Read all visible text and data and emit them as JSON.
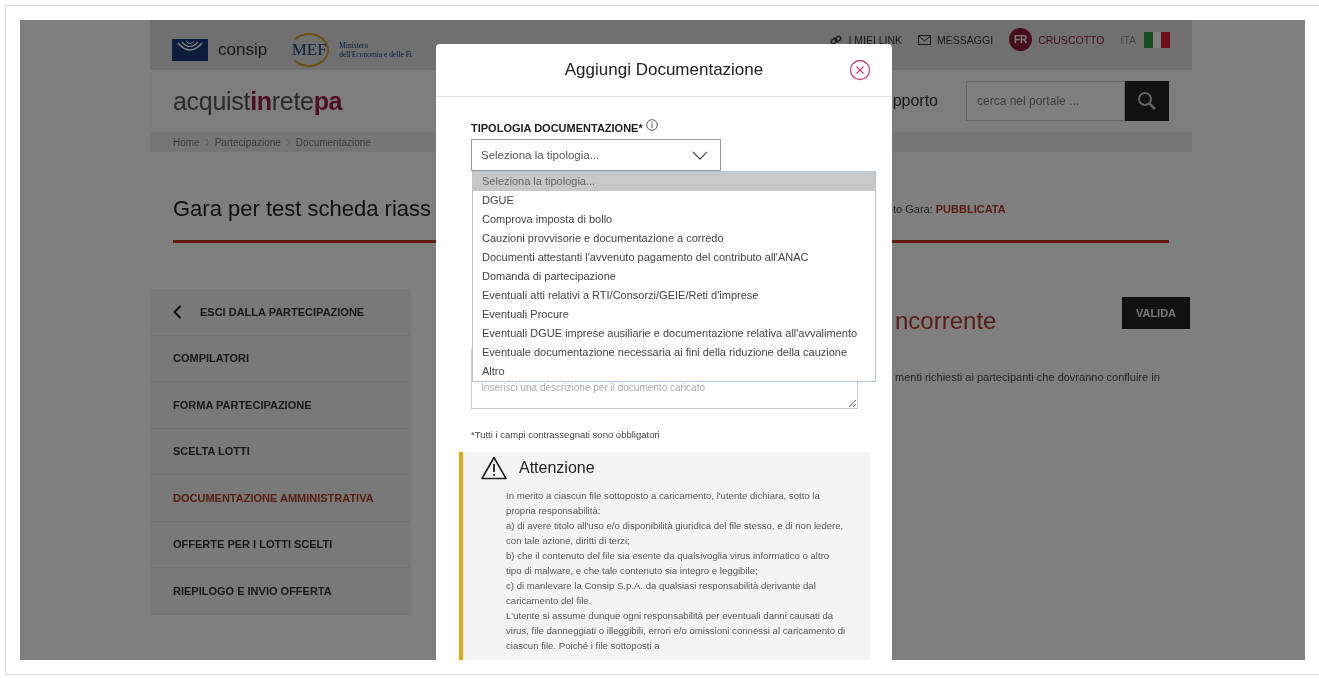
{
  "top_bar": {
    "logo_text": "consip",
    "ministry_logo_text": "MEF",
    "ministry_lines": [
      "Ministero",
      "dell'Economia e delle Fi"
    ],
    "links": [
      {
        "kind": "link",
        "label": "I MIEI LINK"
      },
      {
        "kind": "messages",
        "label": "MESSAGGI"
      },
      {
        "kind": "user",
        "initials": "FR",
        "label": "CRUSCOTTO"
      },
      {
        "kind": "language",
        "label": "ITA"
      }
    ]
  },
  "header": {
    "brand": [
      {
        "text": "acquist",
        "accent": false
      },
      {
        "text": "in",
        "accent": true
      },
      {
        "text": "rete",
        "accent": false
      },
      {
        "text": "pa",
        "accent": true
      }
    ],
    "nav_fragment": "pporto",
    "search": {
      "placeholder": "cerca nel portale ..."
    }
  },
  "breadcrumb": [
    "Home",
    "Partecipazione",
    "Documentazione"
  ],
  "page_title": "Gara per test scheda riass",
  "status_label": "to Gara:",
  "status_value": "PUBBLICATA",
  "sidebar": {
    "back_label": "ESCI DALLA PARTECIPAZIONE",
    "items": [
      {
        "label": "COMPILATORI",
        "selected": false
      },
      {
        "label": "FORMA PARTECIPAZIONE",
        "selected": false
      },
      {
        "label": "SCELTA LOTTI",
        "selected": false
      },
      {
        "label": "DOCUMENTAZIONE AMMINISTRATIVA",
        "selected": true
      },
      {
        "label": "OFFERTE PER I LOTTI SCELTI",
        "selected": false
      },
      {
        "label": "RIEPILOGO E INVIO OFFERTA",
        "selected": false
      }
    ]
  },
  "section_title_fragment": "ncorrente",
  "validate_button": "VALIDA",
  "description_fragment": "menti richiesti ai partecipanti che dovranno confluire in",
  "modal": {
    "title": "Aggiungi Documentazione",
    "field_label": "TIPOLOGIA DOCUMENTAZIONE*",
    "select_placeholder": "Seleziona la tipologia...",
    "options": [
      {
        "label": "Seleziona la tipologia...",
        "selected": true
      },
      {
        "label": "DGUE",
        "selected": false
      },
      {
        "label": "Comprova imposta di bollo",
        "selected": false
      },
      {
        "label": "Cauzioni provvisorie e documentazione a corredo",
        "selected": false
      },
      {
        "label": "Documenti attestanti l'avvenuto pagamento del contributo all'ANAC",
        "selected": false
      },
      {
        "label": "Domanda di partecipazione",
        "selected": false
      },
      {
        "label": "Eventuali atti relativi a RTI/Consorzi/GEIE/Reti d'imprese",
        "selected": false
      },
      {
        "label": "Eventuali Procure",
        "selected": false
      },
      {
        "label": "Eventuali DGUE imprese ausiliarie e documentazione relativa all'avvalimento",
        "selected": false
      },
      {
        "label": "Eventuale documentazione necessaria ai fini della riduzione della cauzione",
        "selected": false
      },
      {
        "label": "Altro",
        "selected": false
      }
    ],
    "description_placeholder": "Inserisci una descrizione per il documento caricato",
    "required_note": "*Tutti i campi contrassegnati sono obbligatori",
    "warning": {
      "title": "Attenzione",
      "paragraphs": [
        "In merito a ciascun file sottoposto a caricamento, l'utente dichiara, sotto la propria responsabilità:",
        "a) di avere titolo all'uso e/o disponibilità giuridica del file stesso, e di non ledere, con tale azione, diritti di terzi;",
        "b) che il contenuto del file sia esente da qualsivoglia virus informatico o altro tipo di malware, e che tale contenuto sia integro e leggibile;",
        "c) di manlevare la Consip S.p.A. da qualsiasi responsabilità derivante dal caricamento del file.",
        "L'utente si assume dunque ogni responsabilità per eventuali danni causati da virus, file danneggiati o illeggibili, errori e/o omissioni connessi al caricamento di ciascun file. Poiché i file sottoposti a"
      ]
    }
  }
}
